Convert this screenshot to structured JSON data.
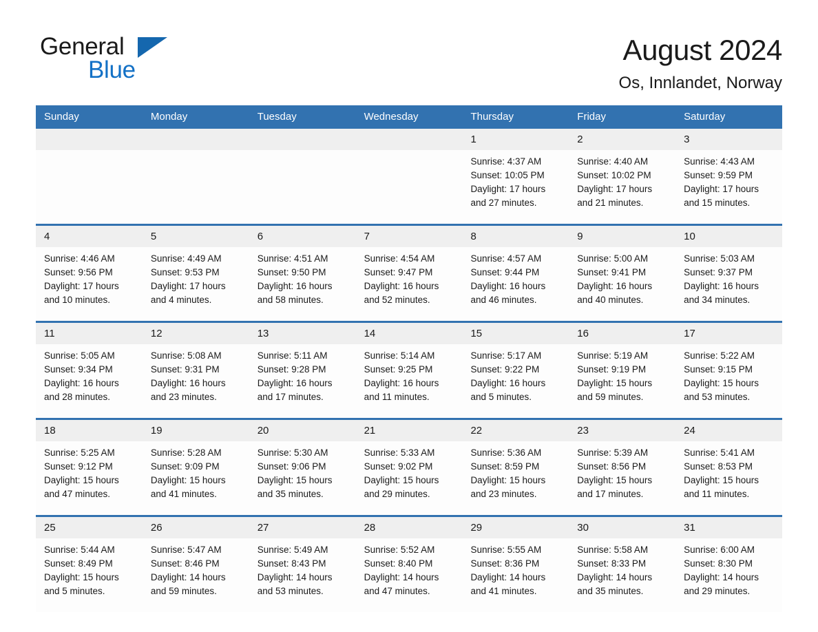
{
  "brand": {
    "name_part1": "General",
    "name_part2": "Blue",
    "triangle_color": "#1567ae",
    "blue_color": "#1371c6"
  },
  "header": {
    "month_title": "August 2024",
    "location": "Os, Innlandet, Norway"
  },
  "colors": {
    "header_blue": "#3272b0",
    "date_strip_gray": "#efefef",
    "text": "#1a1a1a"
  },
  "calendar": {
    "weekdays": [
      "Sunday",
      "Monday",
      "Tuesday",
      "Wednesday",
      "Thursday",
      "Friday",
      "Saturday"
    ],
    "weeks": [
      [
        {
          "date": "",
          "sunrise": "",
          "sunset": "",
          "daylight_1": "",
          "daylight_2": ""
        },
        {
          "date": "",
          "sunrise": "",
          "sunset": "",
          "daylight_1": "",
          "daylight_2": ""
        },
        {
          "date": "",
          "sunrise": "",
          "sunset": "",
          "daylight_1": "",
          "daylight_2": ""
        },
        {
          "date": "",
          "sunrise": "",
          "sunset": "",
          "daylight_1": "",
          "daylight_2": ""
        },
        {
          "date": "1",
          "sunrise": "Sunrise: 4:37 AM",
          "sunset": "Sunset: 10:05 PM",
          "daylight_1": "Daylight: 17 hours",
          "daylight_2": "and 27 minutes."
        },
        {
          "date": "2",
          "sunrise": "Sunrise: 4:40 AM",
          "sunset": "Sunset: 10:02 PM",
          "daylight_1": "Daylight: 17 hours",
          "daylight_2": "and 21 minutes."
        },
        {
          "date": "3",
          "sunrise": "Sunrise: 4:43 AM",
          "sunset": "Sunset: 9:59 PM",
          "daylight_1": "Daylight: 17 hours",
          "daylight_2": "and 15 minutes."
        }
      ],
      [
        {
          "date": "4",
          "sunrise": "Sunrise: 4:46 AM",
          "sunset": "Sunset: 9:56 PM",
          "daylight_1": "Daylight: 17 hours",
          "daylight_2": "and 10 minutes."
        },
        {
          "date": "5",
          "sunrise": "Sunrise: 4:49 AM",
          "sunset": "Sunset: 9:53 PM",
          "daylight_1": "Daylight: 17 hours",
          "daylight_2": "and 4 minutes."
        },
        {
          "date": "6",
          "sunrise": "Sunrise: 4:51 AM",
          "sunset": "Sunset: 9:50 PM",
          "daylight_1": "Daylight: 16 hours",
          "daylight_2": "and 58 minutes."
        },
        {
          "date": "7",
          "sunrise": "Sunrise: 4:54 AM",
          "sunset": "Sunset: 9:47 PM",
          "daylight_1": "Daylight: 16 hours",
          "daylight_2": "and 52 minutes."
        },
        {
          "date": "8",
          "sunrise": "Sunrise: 4:57 AM",
          "sunset": "Sunset: 9:44 PM",
          "daylight_1": "Daylight: 16 hours",
          "daylight_2": "and 46 minutes."
        },
        {
          "date": "9",
          "sunrise": "Sunrise: 5:00 AM",
          "sunset": "Sunset: 9:41 PM",
          "daylight_1": "Daylight: 16 hours",
          "daylight_2": "and 40 minutes."
        },
        {
          "date": "10",
          "sunrise": "Sunrise: 5:03 AM",
          "sunset": "Sunset: 9:37 PM",
          "daylight_1": "Daylight: 16 hours",
          "daylight_2": "and 34 minutes."
        }
      ],
      [
        {
          "date": "11",
          "sunrise": "Sunrise: 5:05 AM",
          "sunset": "Sunset: 9:34 PM",
          "daylight_1": "Daylight: 16 hours",
          "daylight_2": "and 28 minutes."
        },
        {
          "date": "12",
          "sunrise": "Sunrise: 5:08 AM",
          "sunset": "Sunset: 9:31 PM",
          "daylight_1": "Daylight: 16 hours",
          "daylight_2": "and 23 minutes."
        },
        {
          "date": "13",
          "sunrise": "Sunrise: 5:11 AM",
          "sunset": "Sunset: 9:28 PM",
          "daylight_1": "Daylight: 16 hours",
          "daylight_2": "and 17 minutes."
        },
        {
          "date": "14",
          "sunrise": "Sunrise: 5:14 AM",
          "sunset": "Sunset: 9:25 PM",
          "daylight_1": "Daylight: 16 hours",
          "daylight_2": "and 11 minutes."
        },
        {
          "date": "15",
          "sunrise": "Sunrise: 5:17 AM",
          "sunset": "Sunset: 9:22 PM",
          "daylight_1": "Daylight: 16 hours",
          "daylight_2": "and 5 minutes."
        },
        {
          "date": "16",
          "sunrise": "Sunrise: 5:19 AM",
          "sunset": "Sunset: 9:19 PM",
          "daylight_1": "Daylight: 15 hours",
          "daylight_2": "and 59 minutes."
        },
        {
          "date": "17",
          "sunrise": "Sunrise: 5:22 AM",
          "sunset": "Sunset: 9:15 PM",
          "daylight_1": "Daylight: 15 hours",
          "daylight_2": "and 53 minutes."
        }
      ],
      [
        {
          "date": "18",
          "sunrise": "Sunrise: 5:25 AM",
          "sunset": "Sunset: 9:12 PM",
          "daylight_1": "Daylight: 15 hours",
          "daylight_2": "and 47 minutes."
        },
        {
          "date": "19",
          "sunrise": "Sunrise: 5:28 AM",
          "sunset": "Sunset: 9:09 PM",
          "daylight_1": "Daylight: 15 hours",
          "daylight_2": "and 41 minutes."
        },
        {
          "date": "20",
          "sunrise": "Sunrise: 5:30 AM",
          "sunset": "Sunset: 9:06 PM",
          "daylight_1": "Daylight: 15 hours",
          "daylight_2": "and 35 minutes."
        },
        {
          "date": "21",
          "sunrise": "Sunrise: 5:33 AM",
          "sunset": "Sunset: 9:02 PM",
          "daylight_1": "Daylight: 15 hours",
          "daylight_2": "and 29 minutes."
        },
        {
          "date": "22",
          "sunrise": "Sunrise: 5:36 AM",
          "sunset": "Sunset: 8:59 PM",
          "daylight_1": "Daylight: 15 hours",
          "daylight_2": "and 23 minutes."
        },
        {
          "date": "23",
          "sunrise": "Sunrise: 5:39 AM",
          "sunset": "Sunset: 8:56 PM",
          "daylight_1": "Daylight: 15 hours",
          "daylight_2": "and 17 minutes."
        },
        {
          "date": "24",
          "sunrise": "Sunrise: 5:41 AM",
          "sunset": "Sunset: 8:53 PM",
          "daylight_1": "Daylight: 15 hours",
          "daylight_2": "and 11 minutes."
        }
      ],
      [
        {
          "date": "25",
          "sunrise": "Sunrise: 5:44 AM",
          "sunset": "Sunset: 8:49 PM",
          "daylight_1": "Daylight: 15 hours",
          "daylight_2": "and 5 minutes."
        },
        {
          "date": "26",
          "sunrise": "Sunrise: 5:47 AM",
          "sunset": "Sunset: 8:46 PM",
          "daylight_1": "Daylight: 14 hours",
          "daylight_2": "and 59 minutes."
        },
        {
          "date": "27",
          "sunrise": "Sunrise: 5:49 AM",
          "sunset": "Sunset: 8:43 PM",
          "daylight_1": "Daylight: 14 hours",
          "daylight_2": "and 53 minutes."
        },
        {
          "date": "28",
          "sunrise": "Sunrise: 5:52 AM",
          "sunset": "Sunset: 8:40 PM",
          "daylight_1": "Daylight: 14 hours",
          "daylight_2": "and 47 minutes."
        },
        {
          "date": "29",
          "sunrise": "Sunrise: 5:55 AM",
          "sunset": "Sunset: 8:36 PM",
          "daylight_1": "Daylight: 14 hours",
          "daylight_2": "and 41 minutes."
        },
        {
          "date": "30",
          "sunrise": "Sunrise: 5:58 AM",
          "sunset": "Sunset: 8:33 PM",
          "daylight_1": "Daylight: 14 hours",
          "daylight_2": "and 35 minutes."
        },
        {
          "date": "31",
          "sunrise": "Sunrise: 6:00 AM",
          "sunset": "Sunset: 8:30 PM",
          "daylight_1": "Daylight: 14 hours",
          "daylight_2": "and 29 minutes."
        }
      ]
    ]
  }
}
